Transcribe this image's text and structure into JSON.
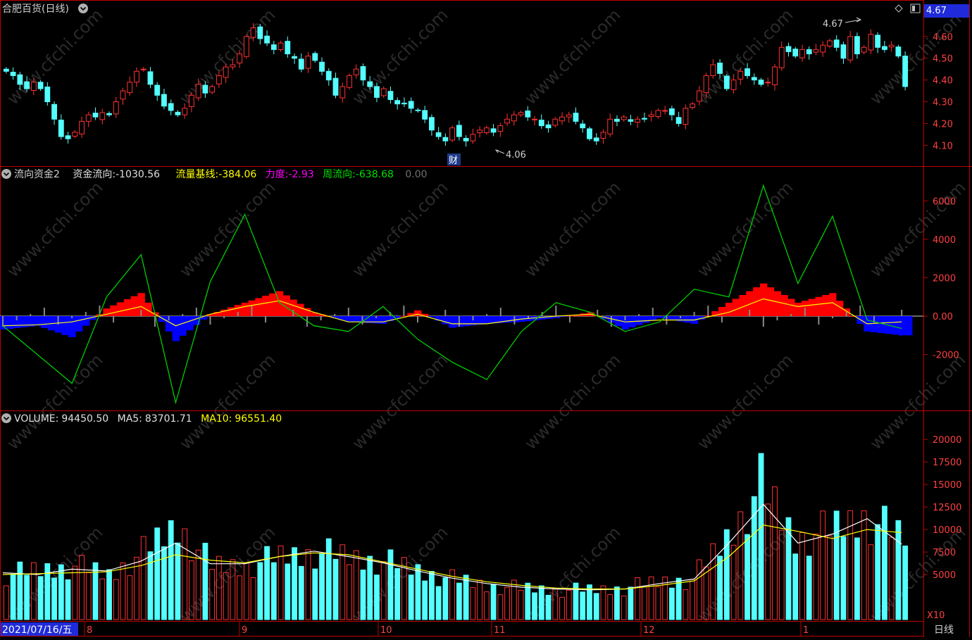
{
  "header": {
    "title": "合肥百货(日线)",
    "last_price": "4.67"
  },
  "indicator": {
    "name": "流向资金2",
    "items": [
      {
        "label": "资金流向:",
        "value": "-1030.56",
        "color": "#e0e0e0"
      },
      {
        "label": "流量基线:",
        "value": "-384.06",
        "color": "#ffff00"
      },
      {
        "label": "力度:",
        "value": "-2.93",
        "color": "#ff00ff"
      },
      {
        "label": "周流向:",
        "value": "-638.68",
        "color": "#00e000"
      }
    ],
    "extra": "0.00"
  },
  "volume": {
    "items": [
      {
        "label": "VOLUME:",
        "value": "94450.50",
        "color": "#e0e0e0"
      },
      {
        "label": "MA5:",
        "value": "83701.71",
        "color": "#e0e0e0"
      },
      {
        "label": "MA10:",
        "value": "96551.40",
        "color": "#ffff00"
      }
    ],
    "multiplier": "X10"
  },
  "annotations": {
    "high_label": "4.67",
    "low_label": "4.06",
    "finance_marker": "财"
  },
  "axis": {
    "start_date": "2021/07/16/五",
    "months": [
      "8",
      "9",
      "10",
      "11",
      "12",
      "1"
    ],
    "period": "日线"
  },
  "watermark": "www.cfchi.com",
  "colors": {
    "up": "#ff3232",
    "down": "#54ffff",
    "frame": "#c00000",
    "inflow": "#ff0000",
    "outflow": "#0000ff",
    "weekly": "#00cc00",
    "baseline": "#ffff00"
  },
  "chart_data": [
    {
      "type": "candlestick",
      "title": "合肥百货(日线)",
      "ylim": [
        4.03,
        4.69
      ],
      "yticks": [
        4.1,
        4.2,
        4.3,
        4.4,
        4.5,
        4.6
      ],
      "ytick_labels": [
        "4.10",
        "4.20",
        "4.30",
        "4.40",
        "4.50",
        "4.60"
      ],
      "close": [
        4.44,
        4.42,
        4.38,
        4.36,
        4.39,
        4.36,
        4.3,
        4.22,
        4.14,
        4.13,
        4.16,
        4.21,
        4.24,
        4.23,
        4.25,
        4.24,
        4.3,
        4.35,
        4.39,
        4.44,
        4.45,
        4.38,
        4.33,
        4.28,
        4.26,
        4.24,
        4.27,
        4.33,
        4.38,
        4.34,
        4.37,
        4.42,
        4.46,
        4.47,
        4.52,
        4.6,
        4.64,
        4.59,
        4.57,
        4.54,
        4.57,
        4.52,
        4.5,
        4.45,
        4.51,
        4.49,
        4.44,
        4.4,
        4.33,
        4.37,
        4.42,
        4.45,
        4.4,
        4.37,
        4.32,
        4.36,
        4.31,
        4.29,
        4.29,
        4.27,
        4.26,
        4.22,
        4.17,
        4.14,
        4.12,
        4.18,
        4.14,
        4.12,
        4.15,
        4.17,
        4.18,
        4.16,
        4.19,
        4.22,
        4.24,
        4.25,
        4.23,
        4.22,
        4.19,
        4.18,
        4.22,
        4.23,
        4.24,
        4.21,
        4.18,
        4.13,
        4.12,
        4.16,
        4.22,
        4.21,
        4.23,
        4.21,
        4.22,
        4.22,
        4.24,
        4.26,
        4.26,
        4.24,
        4.2,
        4.27,
        4.29,
        4.35,
        4.42,
        4.47,
        4.43,
        4.36,
        4.4,
        4.44,
        4.42,
        4.4,
        4.38,
        4.39,
        4.46,
        4.55,
        4.53,
        4.51,
        4.54,
        4.52,
        4.54,
        4.56,
        4.58,
        4.55,
        4.5,
        4.6,
        4.52,
        4.55,
        4.61,
        4.55,
        4.54,
        4.56,
        4.51,
        4.37
      ],
      "annotations": [
        {
          "text": "4.67",
          "kind": "high"
        },
        {
          "text": "4.06",
          "kind": "low"
        },
        {
          "text": "财",
          "kind": "marker"
        }
      ]
    },
    {
      "type": "bar+line",
      "title": "流向资金2",
      "ylim": [
        -4800,
        7000
      ],
      "yticks": [
        -2000,
        0,
        2000,
        4000,
        6000
      ],
      "ytick_labels": [
        "-2000",
        "0.00",
        "2000",
        "4000",
        "6000"
      ],
      "series": [
        {
          "name": "资金流向",
          "kind": "bar",
          "x": [
            0,
            5,
            10,
            15,
            20,
            25,
            30,
            35,
            40,
            45,
            50,
            55,
            60,
            65,
            70,
            75,
            80,
            85,
            90,
            95,
            100,
            105,
            110,
            115,
            120,
            125,
            130
          ],
          "values": [
            -700,
            -500,
            -1100,
            400,
            1200,
            -1300,
            100,
            700,
            1300,
            200,
            -300,
            -400,
            300,
            -600,
            -400,
            -300,
            -100,
            200,
            -700,
            -100,
            -400,
            700,
            1700,
            700,
            1200,
            -800,
            -1000
          ]
        },
        {
          "name": "流量基线",
          "kind": "line",
          "x": [
            0,
            5,
            10,
            15,
            20,
            25,
            30,
            35,
            40,
            45,
            50,
            55,
            60,
            65,
            70,
            75,
            80,
            85,
            90,
            95,
            100,
            105,
            110,
            115,
            120,
            125,
            130
          ],
          "values": [
            -500,
            -450,
            -300,
            100,
            500,
            -500,
            100,
            500,
            800,
            200,
            -300,
            -300,
            100,
            -400,
            -400,
            -150,
            0,
            100,
            -300,
            -200,
            -200,
            200,
            900,
            500,
            700,
            -400,
            -300
          ]
        },
        {
          "name": "周流向",
          "kind": "line",
          "x": [
            0,
            5,
            10,
            15,
            20,
            25,
            30,
            35,
            40,
            45,
            50,
            55,
            60,
            65,
            70,
            75,
            80,
            85,
            90,
            95,
            100,
            105,
            110,
            115,
            120,
            125,
            130
          ],
          "values": [
            -500,
            -2000,
            -3500,
            1000,
            3200,
            -4500,
            1800,
            5300,
            700,
            -500,
            -800,
            500,
            -1200,
            -2400,
            -3300,
            -800,
            700,
            200,
            -800,
            -300,
            1400,
            1000,
            6800,
            1700,
            5200,
            -200,
            -640
          ]
        }
      ]
    },
    {
      "type": "volume",
      "title": "VOLUME",
      "ylim": [
        0,
        21500
      ],
      "yticks": [
        5000,
        7500,
        10000,
        12500,
        15000,
        17500,
        20000
      ],
      "ytick_labels": [
        "5000",
        "7500",
        "10000",
        "12500",
        "15000",
        "17500",
        "20000"
      ],
      "x": [
        0,
        5,
        10,
        15,
        20,
        25,
        30,
        35,
        40,
        45,
        50,
        55,
        60,
        65,
        70,
        75,
        80,
        85,
        90,
        95,
        100,
        105,
        110,
        115,
        120,
        125,
        130
      ],
      "values": [
        5000,
        5500,
        6000,
        5000,
        7500,
        10500,
        6000,
        6000,
        7000,
        7500,
        7000,
        6500,
        5500,
        4500,
        3800,
        3500,
        3300,
        3300,
        3500,
        4200,
        4500,
        9000,
        15000,
        9000,
        10000,
        11500,
        9400
      ],
      "series": [
        {
          "name": "MA5",
          "values": [
            5200,
            5000,
            5600,
            5400,
            6500,
            8500,
            6200,
            6200,
            7000,
            7600,
            7000,
            6300,
            5400,
            4600,
            4000,
            3600,
            3400,
            3300,
            3400,
            4000,
            4500,
            8500,
            12800,
            8500,
            9500,
            11200,
            8370
          ]
        },
        {
          "name": "MA10",
          "values": [
            5000,
            5100,
            5200,
            5300,
            6000,
            7200,
            6600,
            6300,
            7000,
            7400,
            7200,
            6400,
            5600,
            4800,
            4200,
            3800,
            3500,
            3400,
            3400,
            3800,
            4300,
            7000,
            10500,
            9800,
            9000,
            10000,
            9655
          ]
        }
      ]
    }
  ]
}
